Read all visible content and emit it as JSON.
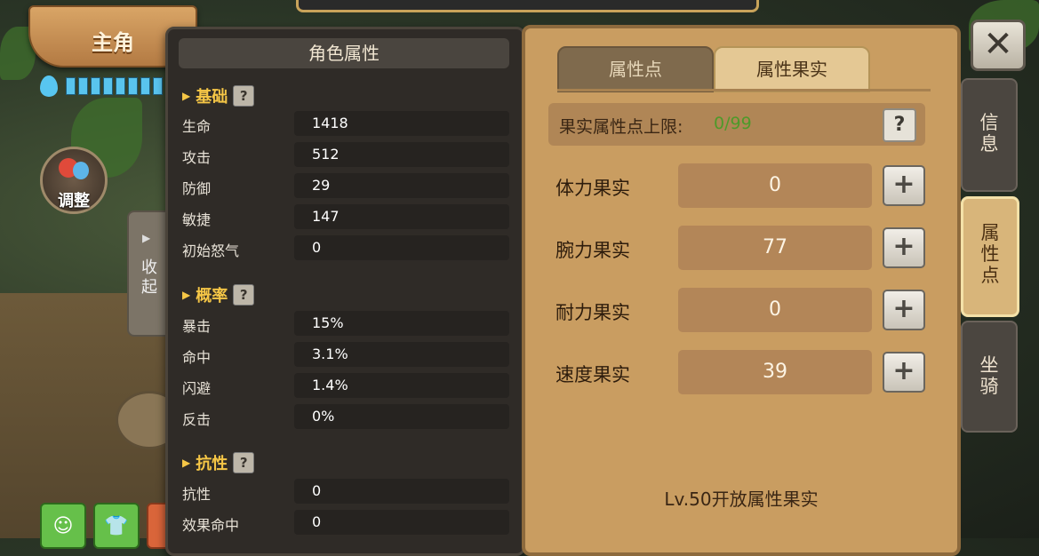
{
  "title": "主角",
  "adjust_label": "调整",
  "collapse_label": "收起",
  "attributes_panel": {
    "header": "角色属性",
    "sections": [
      {
        "title": "基础",
        "help": "?",
        "rows": [
          {
            "label": "生命",
            "value": "1418"
          },
          {
            "label": "攻击",
            "value": "512"
          },
          {
            "label": "防御",
            "value": "29"
          },
          {
            "label": "敏捷",
            "value": "147"
          },
          {
            "label": "初始怒气",
            "value": "0"
          }
        ]
      },
      {
        "title": "概率",
        "help": "?",
        "rows": [
          {
            "label": "暴击",
            "value": "15%"
          },
          {
            "label": "命中",
            "value": "3.1%"
          },
          {
            "label": "闪避",
            "value": "1.4%"
          },
          {
            "label": "反击",
            "value": "0%"
          }
        ]
      },
      {
        "title": "抗性",
        "help": "?",
        "rows": [
          {
            "label": "抗性",
            "value": "0"
          },
          {
            "label": "效果命中",
            "value": "0"
          }
        ]
      }
    ]
  },
  "fruit_panel": {
    "tabs": [
      {
        "label": "属性点",
        "active": false
      },
      {
        "label": "属性果实",
        "active": true
      }
    ],
    "limit": {
      "label": "果实属性点上限:",
      "value": "0/99",
      "help": "?"
    },
    "fruits": [
      {
        "label": "体力果实",
        "value": "0"
      },
      {
        "label": "腕力果实",
        "value": "77"
      },
      {
        "label": "耐力果实",
        "value": "0"
      },
      {
        "label": "速度果实",
        "value": "39"
      }
    ],
    "note": "Lv.50开放属性果实"
  },
  "side_tabs": [
    {
      "label": "信息",
      "active": false
    },
    {
      "label": "属性点",
      "active": true
    },
    {
      "label": "坐骑",
      "active": false
    }
  ],
  "icons": {
    "close": "close-icon",
    "plus": "plus-icon",
    "water": "water-drop-icon"
  },
  "colors": {
    "accent_gold": "#f5c646",
    "limit_green": "#4e9a2a",
    "panel_dark": "#2f2b27",
    "panel_tan": "#c99d61"
  }
}
